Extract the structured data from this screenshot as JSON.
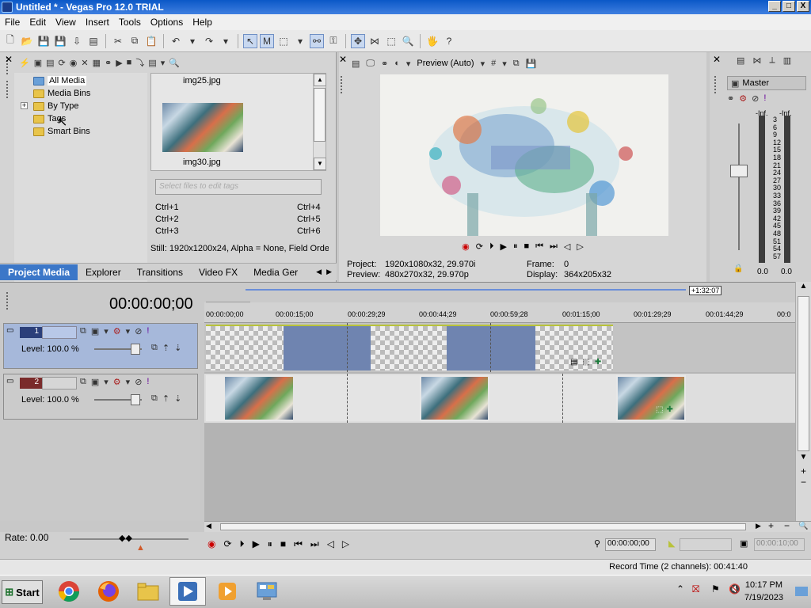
{
  "window": {
    "title": "Untitled * - Vegas Pro 12.0 TRIAL",
    "min": "_",
    "max": "□",
    "close": "X"
  },
  "menu": [
    "File",
    "Edit",
    "View",
    "Insert",
    "Tools",
    "Options",
    "Help"
  ],
  "media_tree": {
    "items": [
      "All Media",
      "Media Bins",
      "By Type",
      "Tags",
      "Smart Bins"
    ],
    "selected": "All Media"
  },
  "file_list": {
    "items": [
      {
        "name": "img25.jpg"
      },
      {
        "name": "img30.jpg"
      }
    ]
  },
  "tags": {
    "search_placeholder": "Select files to edit tags",
    "shortcuts_left": [
      "Ctrl+1",
      "Ctrl+2",
      "Ctrl+3"
    ],
    "shortcuts_right": [
      "Ctrl+4",
      "Ctrl+5",
      "Ctrl+6"
    ]
  },
  "still_info": "Still: 1920x1200x24, Alpha = None, Field Orde",
  "tabs": [
    "Project Media",
    "Explorer",
    "Transitions",
    "Video FX",
    "Media Ger"
  ],
  "active_tab": "Project Media",
  "preview": {
    "mode": "Preview (Auto)",
    "project_label": "Project:",
    "project_value": "1920x1080x32, 29.970i",
    "preview_label": "Preview:",
    "preview_value": "480x270x32, 29.970p",
    "frame_label": "Frame:",
    "frame_value": "0",
    "display_label": "Display:",
    "display_value": "364x205x32"
  },
  "mixer": {
    "title": "Master",
    "inf_left": "-Inf.",
    "inf_right": "-Inf.",
    "scale": [
      "3",
      "6",
      "9",
      "12",
      "15",
      "18",
      "21",
      "24",
      "27",
      "30",
      "33",
      "36",
      "39",
      "42",
      "45",
      "48",
      "51",
      "54",
      "57"
    ],
    "val_left": "0.0",
    "val_right": "0.0"
  },
  "timeline": {
    "timecode": "00:00:00;00",
    "end_marker": "+1:32:07",
    "ruler": [
      "00:00:00;00",
      "00:00:15;00",
      "00:00:29;29",
      "00:00:44;29",
      "00:00:59;28",
      "00:01:15;00",
      "00:01:29;29",
      "00:01:44;29",
      "00:0"
    ],
    "tracks": [
      {
        "num": "1",
        "level": "Level: 100.0 %"
      },
      {
        "num": "2",
        "level": "Level: 100.0 %"
      }
    ]
  },
  "transport": {
    "rate": "Rate: 0.00",
    "cursor_time": "00:00:00;00",
    "end_time": "00:00:10;00"
  },
  "status": {
    "record_time": "Record Time (2 channels): 00:41:40"
  },
  "taskbar": {
    "start": "Start",
    "time": "10:17 PM",
    "date": "7/19/2023"
  }
}
